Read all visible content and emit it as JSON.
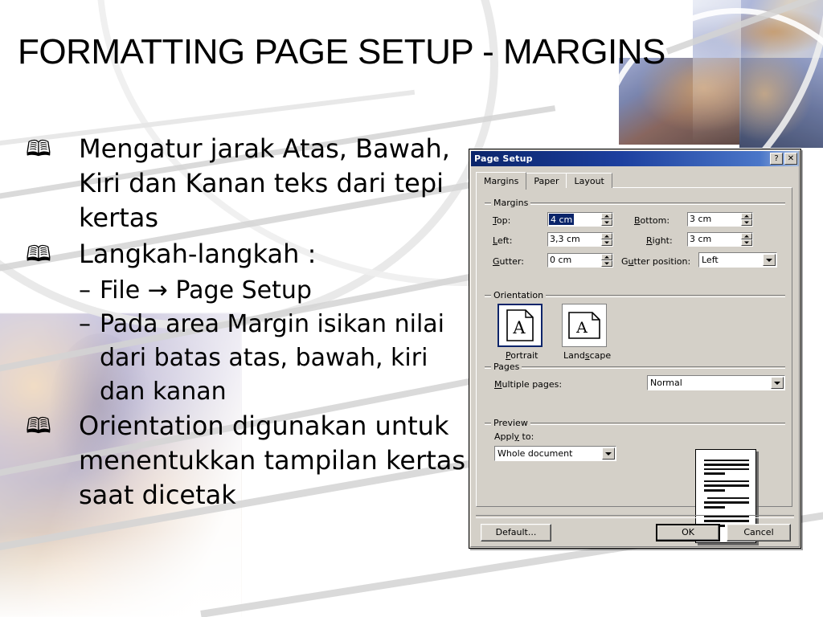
{
  "slide": {
    "title": "FORMATTING PAGE SETUP - MARGINS",
    "bullet_glyph": "🕮",
    "dash_glyph": "–",
    "arrow_glyph": "→",
    "bullets": [
      {
        "level": 1,
        "text": "Mengatur jarak Atas, Bawah, Kiri dan Kanan teks dari tepi kertas"
      },
      {
        "level": 1,
        "text": "Langkah-langkah :"
      },
      {
        "level": 2,
        "text": "File → Page Setup"
      },
      {
        "level": 2,
        "text": "Pada area Margin isikan nilai dari batas atas, bawah, kiri dan kanan"
      },
      {
        "level": 1,
        "text": "Orientation digunakan untuk menentukkan tampilan kertas saat dicetak"
      }
    ]
  },
  "dialog": {
    "title": "Page Setup",
    "titlebar_help": "?",
    "titlebar_close": "✕",
    "titlebar_color": "#0a246a",
    "face_color": "#d4d0c8",
    "tabs": [
      {
        "label": "Margins",
        "active": true
      },
      {
        "label": "Paper",
        "active": false
      },
      {
        "label": "Layout",
        "active": false
      }
    ],
    "margins_group": {
      "legend": "Margins",
      "fields": [
        {
          "name": "top",
          "label": "Top:",
          "value": "4 cm",
          "selected": true
        },
        {
          "name": "bottom",
          "label": "Bottom:",
          "value": "3 cm",
          "selected": false
        },
        {
          "name": "left",
          "label": "Left:",
          "value": "3,3 cm",
          "selected": false
        },
        {
          "name": "right",
          "label": "Right:",
          "value": "3 cm",
          "selected": false
        },
        {
          "name": "gutter",
          "label": "Gutter:",
          "value": "0 cm",
          "selected": false
        }
      ],
      "gutter_position": {
        "label": "Gutter position:",
        "value": "Left"
      }
    },
    "orientation_group": {
      "legend": "Orientation",
      "options": [
        {
          "label": "Portrait",
          "selected": true
        },
        {
          "label": "Landscape",
          "selected": false
        }
      ]
    },
    "pages_group": {
      "legend": "Pages",
      "multiple_pages_label": "Multiple pages:",
      "multiple_pages_value": "Normal"
    },
    "preview_group": {
      "legend": "Preview",
      "apply_to_label": "Apply to:",
      "apply_to_value": "Whole document"
    },
    "buttons": {
      "default": "Default...",
      "ok": "OK",
      "cancel": "Cancel"
    }
  }
}
